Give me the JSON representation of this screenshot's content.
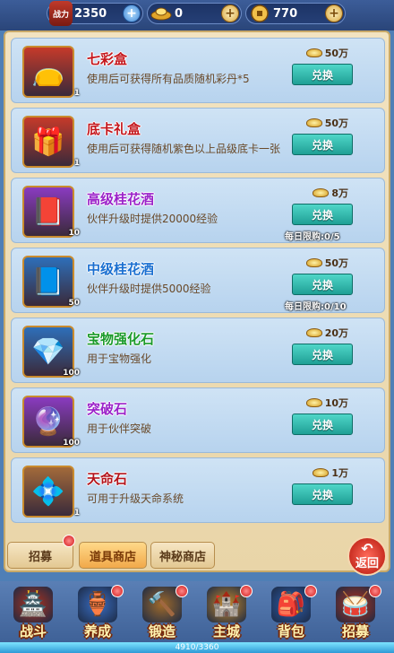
{
  "header": {
    "power_label": "战力",
    "power_value": "2350",
    "ingot_value": "0",
    "coin_value": "770"
  },
  "items": [
    {
      "name": "七彩盒",
      "name_color": "#c4161c",
      "desc": "使用后可获得所有品质随机彩丹*5",
      "count": "1",
      "price": "50万",
      "button": "兑换",
      "limit": "",
      "icon": "gift-bag-icon",
      "thumb_bg": "#c53a2a",
      "thumb_glyph": "👝"
    },
    {
      "name": "底卡礼盒",
      "name_color": "#c4161c",
      "desc": "使用后可获得随机紫色以上品级底卡一张",
      "count": "1",
      "price": "50万",
      "button": "兑换",
      "limit": "",
      "icon": "gift-pouch-icon",
      "thumb_bg": "#c53a2a",
      "thumb_glyph": "🎁"
    },
    {
      "name": "高级桂花酒",
      "name_color": "#9a22c9",
      "desc": "伙伴升级时提供20000经验",
      "count": "10",
      "price": "8万",
      "button": "兑换",
      "limit": "每日限购:0/5",
      "icon": "purple-book-icon",
      "thumb_bg": "#8a3bc0",
      "thumb_glyph": "📕"
    },
    {
      "name": "中级桂花酒",
      "name_color": "#1a6fd0",
      "desc": "伙伴升级时提供5000经验",
      "count": "50",
      "price": "50万",
      "button": "兑换",
      "limit": "每日限购:0/10",
      "icon": "blue-book-icon",
      "thumb_bg": "#2e6fb9",
      "thumb_glyph": "📘"
    },
    {
      "name": "宝物强化石",
      "name_color": "#1a9a2a",
      "desc": "用于宝物强化",
      "count": "100",
      "price": "20万",
      "button": "兑换",
      "limit": "",
      "icon": "amber-gem-icon",
      "thumb_bg": "#2e6fb9",
      "thumb_glyph": "💎"
    },
    {
      "name": "突破石",
      "name_color": "#9a22c9",
      "desc": "用于伙伴突破",
      "count": "100",
      "price": "10万",
      "button": "兑换",
      "limit": "",
      "icon": "purple-gem-icon",
      "thumb_bg": "#8a3bc0",
      "thumb_glyph": "🔮"
    },
    {
      "name": "天命石",
      "name_color": "#b3141c",
      "desc": "可用于升级天命系统",
      "count": "1",
      "price": "1万",
      "button": "兑换",
      "limit": "",
      "icon": "crystal-stone-icon",
      "thumb_bg": "#a36a3a",
      "thumb_glyph": "💠"
    }
  ],
  "tabs": [
    {
      "label": "招募",
      "active": false
    },
    {
      "label": "道具商店",
      "active": true
    },
    {
      "label": "神秘商店",
      "active": false
    }
  ],
  "back_label": "返回",
  "nav": [
    {
      "label": "战斗",
      "glyph": "🏯"
    },
    {
      "label": "养成",
      "glyph": "🏺"
    },
    {
      "label": "锻造",
      "glyph": "🔨"
    },
    {
      "label": "主城",
      "glyph": "🏰"
    },
    {
      "label": "背包",
      "glyph": "🎒"
    },
    {
      "label": "招募",
      "glyph": "🥁"
    }
  ],
  "exp": {
    "text": "4910/3360",
    "fill_fraction": 1.0
  },
  "colors": {
    "button": "#2bb3a8",
    "card": "#c3dbf2",
    "panel": "#efdfb8"
  }
}
